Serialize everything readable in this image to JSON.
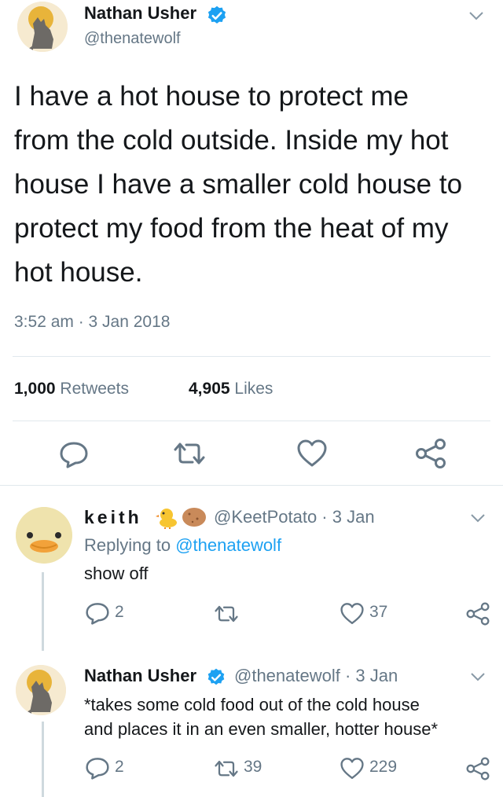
{
  "tweet": {
    "author_name": "Nathan Usher",
    "author_handle": "@thenatewolf",
    "lines": [
      "I have a hot house to protect me",
      "from the cold outside. Inside my hot",
      "house I have a smaller cold house to",
      "protect my food from the heat of my",
      "hot house."
    ],
    "timestamp": "3:52 am · 3 Jan 2018",
    "retweets_count": "1,000",
    "retweets_label": "Retweets",
    "likes_count": "4,905",
    "likes_label": "Likes"
  },
  "reply1": {
    "author_name": "keith",
    "handle_date": "@KeetPotato · 3 Jan",
    "replying_prefix": "Replying to",
    "replying_to": "@thenatewolf",
    "text": "show off",
    "reply_count": "2",
    "retweet_count": "",
    "like_count": "37"
  },
  "reply2": {
    "author_name": "Nathan Usher",
    "handle_date": "@thenatewolf · 3 Jan",
    "lines": [
      "*takes some cold food out of the cold house",
      "and places it in an even smaller, hotter house*"
    ],
    "reply_count": "2",
    "retweet_count": "39",
    "like_count": "229"
  },
  "colors": {
    "accent": "#1da1f2",
    "muted": "#657786",
    "text": "#14171a",
    "divider": "#e1e8ed"
  }
}
